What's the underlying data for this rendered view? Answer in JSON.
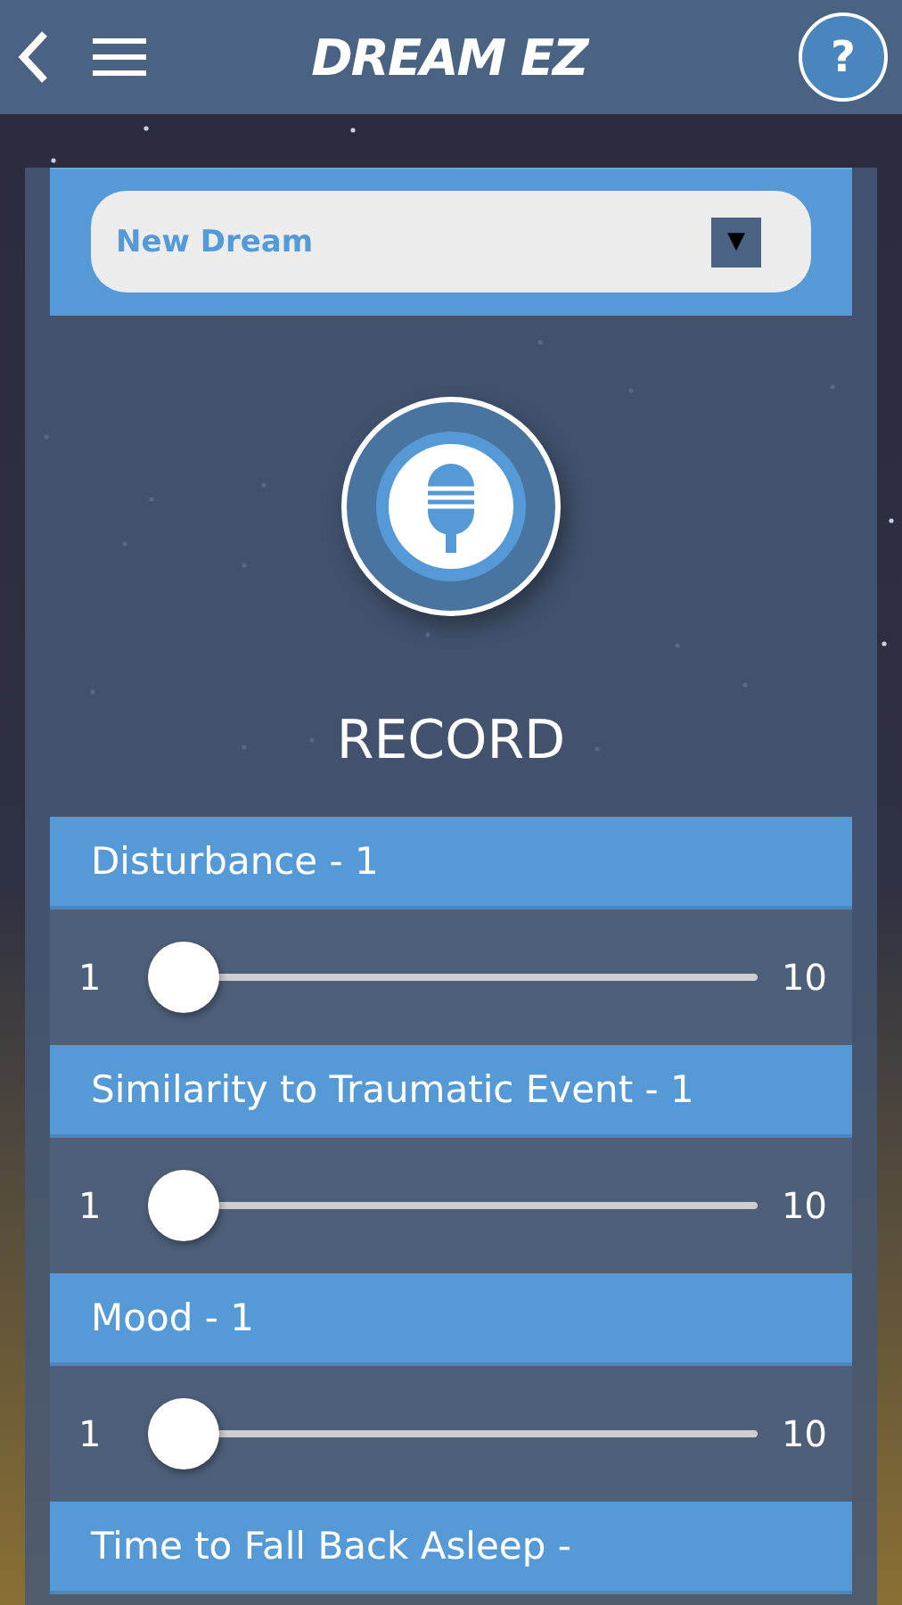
{
  "app_bar": {
    "title": "DREAM EZ",
    "help": "?"
  },
  "dream_select": {
    "value": "New Dream",
    "caret": "▼"
  },
  "record": {
    "label": "RECORD"
  },
  "ratings": [
    {
      "title": "Disturbance - 1",
      "min": "1",
      "max": "10",
      "level": 0
    },
    {
      "title": "Similarity to Traumatic Event - 1",
      "min": "1",
      "max": "10",
      "level": 0
    },
    {
      "title": "Mood - 1",
      "min": "1",
      "max": "10",
      "level": 0
    },
    {
      "title": "Time to Fall Back Asleep -"
    }
  ]
}
